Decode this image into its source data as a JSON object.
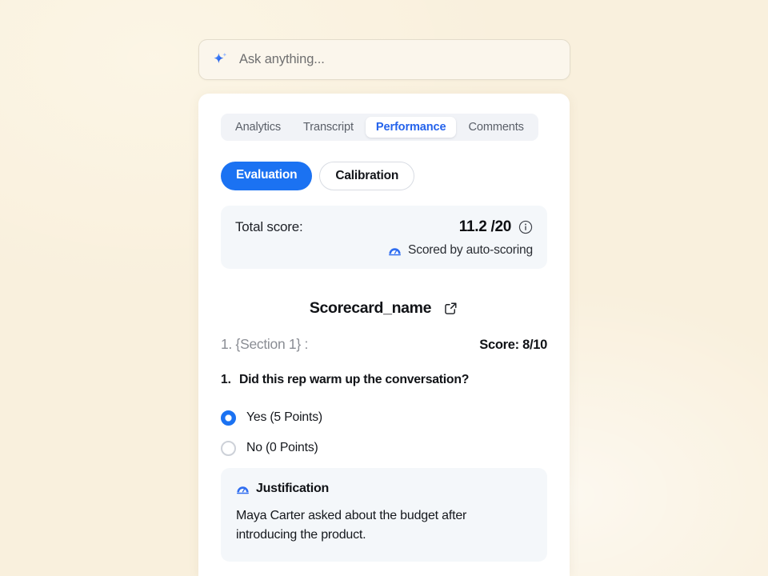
{
  "ask": {
    "placeholder": "Ask anything...",
    "icon": "sparkle-icon"
  },
  "tabs": [
    {
      "label": "Analytics",
      "active": false
    },
    {
      "label": "Transcript",
      "active": false
    },
    {
      "label": "Performance",
      "active": true
    },
    {
      "label": "Comments",
      "active": false
    }
  ],
  "modes": [
    {
      "label": "Evaluation",
      "active": true
    },
    {
      "label": "Calibration",
      "active": false
    }
  ],
  "score_card": {
    "label": "Total score:",
    "value": "11.2 /20",
    "info_icon": "info-circle-icon",
    "scored_by_icon": "gauge-icon",
    "scored_by": "Scored by auto-scoring"
  },
  "scorecard": {
    "title": "Scorecard_name",
    "open_icon": "external-link-icon"
  },
  "section": {
    "name": "1. {Section 1} :",
    "score": "Score: 8/10"
  },
  "question": {
    "number": "1.",
    "text": "Did this rep warm up the conversation?",
    "options": [
      {
        "label": "Yes (5 Points)",
        "selected": true
      },
      {
        "label": "No (0 Points)",
        "selected": false
      }
    ]
  },
  "justification": {
    "icon": "gauge-icon",
    "title": "Justification",
    "body": "Maya Carter asked about the budget after introducing the product."
  },
  "colors": {
    "page_background": "#f9f0dd",
    "accent_blue": "#1b72f2",
    "tab_active_text": "#2563eb",
    "card_surface": "#f4f7fa",
    "panel": "#ffffff"
  }
}
